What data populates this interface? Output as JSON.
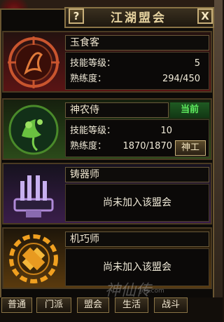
{
  "window": {
    "title": "江湖盟会",
    "help_label": "?",
    "close_label": "X"
  },
  "guilds": [
    {
      "name": "玉食客",
      "skill_level_label": "技能等级：",
      "skill_level": "5",
      "proficiency_label": "熟练度：",
      "proficiency": "294/450",
      "emblem_color": "#c9552e"
    },
    {
      "name": "神农侍",
      "status": "当前",
      "skill_level_label": "技能等级：",
      "skill_level": "10",
      "proficiency_label": "熟练度：",
      "proficiency": "1870/1870",
      "action_label": "神工",
      "emblem_color": "#7ad04a"
    },
    {
      "name": "铸器师",
      "not_joined": "尚未加入该盟会",
      "emblem_color": "#b08ad8"
    },
    {
      "name": "机巧师",
      "not_joined": "尚未加入该盟会",
      "emblem_color": "#f0a020"
    }
  ],
  "tabs": [
    "普通",
    "门派",
    "盟会",
    "生活",
    "战斗"
  ],
  "watermark": "神仙传",
  "watermark_url": "jos.com"
}
